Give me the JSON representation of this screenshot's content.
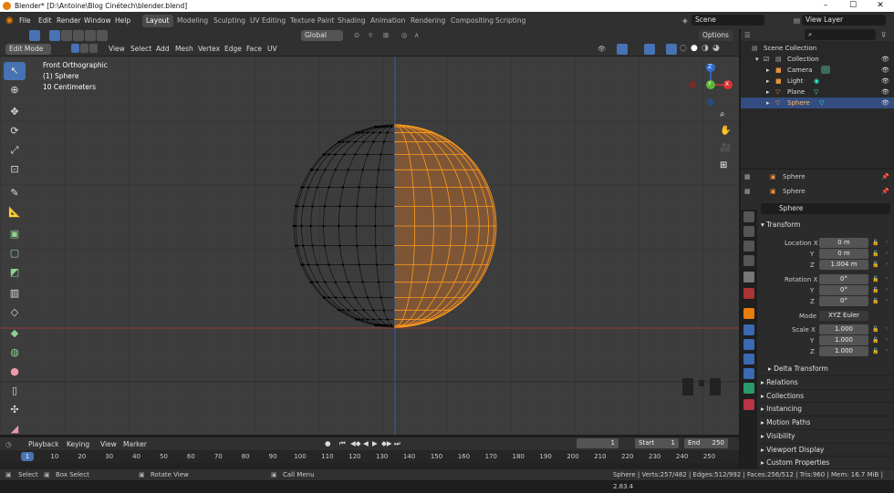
{
  "window": {
    "title": "Blender* [D:\\Antoine\\Blog Cinétech\\blender.blend]"
  },
  "menu": [
    "File",
    "Edit",
    "Render",
    "Window",
    "Help"
  ],
  "workspaces": [
    {
      "label": "Layout",
      "active": true
    },
    {
      "label": "Modeling"
    },
    {
      "label": "Sculpting"
    },
    {
      "label": "UV Editing"
    },
    {
      "label": "Texture Paint"
    },
    {
      "label": "Shading"
    },
    {
      "label": "Animation"
    },
    {
      "label": "Rendering"
    },
    {
      "label": "Compositing"
    },
    {
      "label": "Scripting"
    }
  ],
  "scene": {
    "name": "Scene",
    "view_layer": "View Layer"
  },
  "viewport_header": {
    "mode": "Edit Mode",
    "menus": [
      "View",
      "Select",
      "Add",
      "Mesh",
      "Vertex",
      "Edge",
      "Face",
      "UV"
    ],
    "transform_orientation": "Global",
    "options": "Options"
  },
  "overlay": {
    "view": "Front Orthographic",
    "object": "(1) Sphere",
    "scale": "10 Centimeters"
  },
  "gizmo": {
    "z": "Z",
    "y": "Y",
    "x": "X"
  },
  "timeline": {
    "menus": [
      "Playback",
      "Keying",
      "View",
      "Marker"
    ],
    "current_frame": "1",
    "start_label": "Start",
    "start": "1",
    "end_label": "End",
    "end": "250",
    "ticks": [
      "1",
      "10",
      "20",
      "30",
      "40",
      "50",
      "60",
      "70",
      "80",
      "90",
      "100",
      "110",
      "120",
      "130",
      "140",
      "150",
      "160",
      "170",
      "180",
      "190",
      "200",
      "210",
      "220",
      "230",
      "240",
      "250"
    ]
  },
  "status": {
    "select": "Select",
    "box_select": "Box Select",
    "rotate": "Rotate View",
    "call_menu": "Call Menu",
    "info": "Sphere | Verts:257/482 | Edges:512/992 | Faces:256/512 | Tris:960 | Mem: 16.7 MiB | 2.83.4"
  },
  "outliner": {
    "root": "Scene Collection",
    "collection": "Collection",
    "items": [
      {
        "label": "Camera"
      },
      {
        "label": "Light"
      },
      {
        "label": "Plane"
      },
      {
        "label": "Sphere",
        "selected": true
      }
    ]
  },
  "properties": {
    "object_name": "Sphere",
    "data_name": "Sphere",
    "name_field": "Sphere",
    "transform_label": "Transform",
    "location_label": "Location X",
    "y": "Y",
    "z": "Z",
    "location": [
      "0 m",
      "0 m",
      "1.004 m"
    ],
    "rotation_label": "Rotation X",
    "rotation": [
      "0°",
      "0°",
      "0°"
    ],
    "mode_label": "Mode",
    "mode": "XYZ Euler",
    "scale_label": "Scale X",
    "scale": [
      "1.000",
      "1.000",
      "1.000"
    ],
    "sections": [
      "Delta Transform",
      "Relations",
      "Collections",
      "Instancing",
      "Motion Paths",
      "Visibility",
      "Viewport Display",
      "Custom Properties"
    ]
  },
  "colors": {
    "accent": "#4772b3",
    "orange": "#e87d0d",
    "sphere_sel": "#ff9a1a"
  }
}
